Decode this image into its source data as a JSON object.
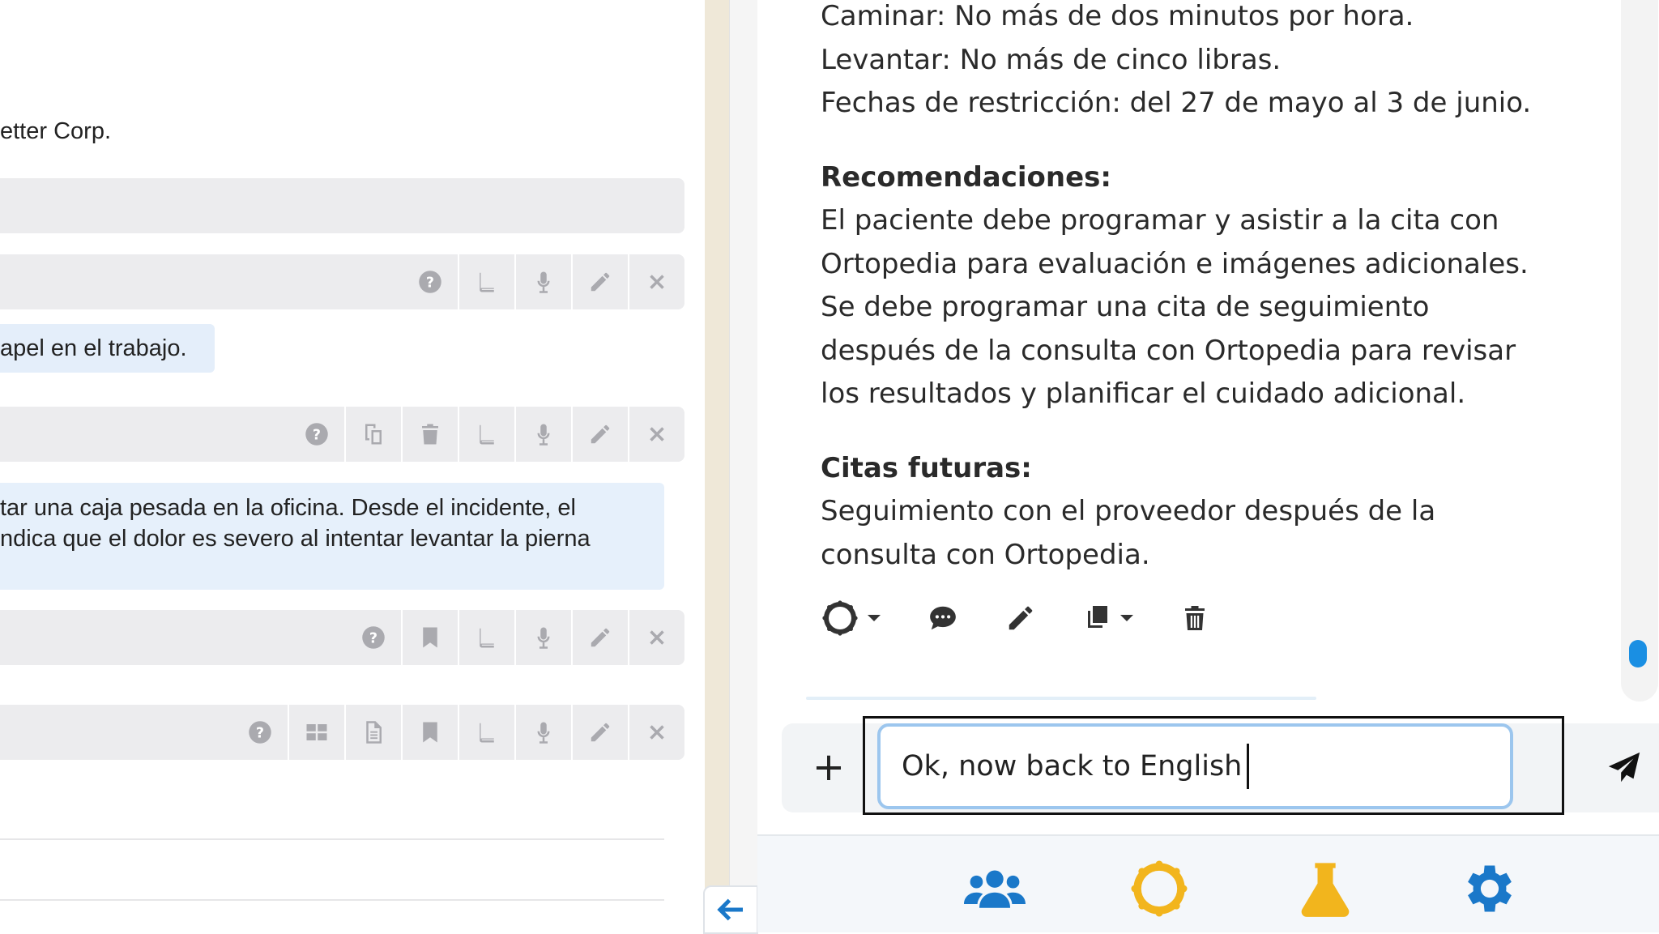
{
  "left_panel": {
    "company_fragment": "etter Corp.",
    "chip_text": "apel en el trabajo.",
    "message_lines": [
      "tar una caja pesada en la oficina. Desde el incidente, el",
      "ndica que el dolor es severo al intentar levantar la pierna"
    ],
    "toolbar_icons": {
      "row1": [
        "help-icon",
        "book-icon",
        "mic-icon",
        "pencil-icon",
        "close-icon"
      ],
      "row2": [
        "help-icon",
        "copy-icon",
        "trash-icon",
        "book-icon",
        "mic-icon",
        "pencil-icon",
        "close-icon"
      ],
      "row3": [
        "help-icon",
        "bookmark-icon",
        "book-icon",
        "mic-icon",
        "pencil-icon",
        "close-icon"
      ],
      "row4": [
        "help-icon",
        "grid-icon",
        "document-icon",
        "bookmark-icon",
        "book-icon",
        "mic-icon",
        "pencil-icon",
        "close-icon"
      ]
    }
  },
  "chat": {
    "restrictions": [
      "Caminar: No más de dos minutos por hora.",
      "Levantar: No más de cinco libras.",
      "Fechas de restricción: del 27 de mayo al 3 de junio."
    ],
    "recommendations_heading": "Recomendaciones:",
    "recommendations_lines": [
      "El paciente debe programar y asistir a la cita con",
      "Ortopedia para evaluación e imágenes adicionales.",
      "Se debe programar una cita de seguimiento",
      "después de la consulta con Ortopedia para revisar",
      "los resultados y planificar el cuidado adicional."
    ],
    "appointments_heading": "Citas futuras:",
    "appointments_lines": [
      "Seguimiento con el proveedor después de la",
      "consulta con Ortopedia."
    ]
  },
  "composer": {
    "plus_label": "+",
    "input_value": "Ok, now back to English"
  },
  "colors": {
    "accent_blue": "#1a78c9",
    "nav_gold": "#f2b51d",
    "nav_blue": "#1a78c9",
    "input_border": "#9cc6ee"
  },
  "bottom_nav": [
    "people-icon",
    "sun-icon",
    "flask-icon",
    "gear-icon"
  ]
}
